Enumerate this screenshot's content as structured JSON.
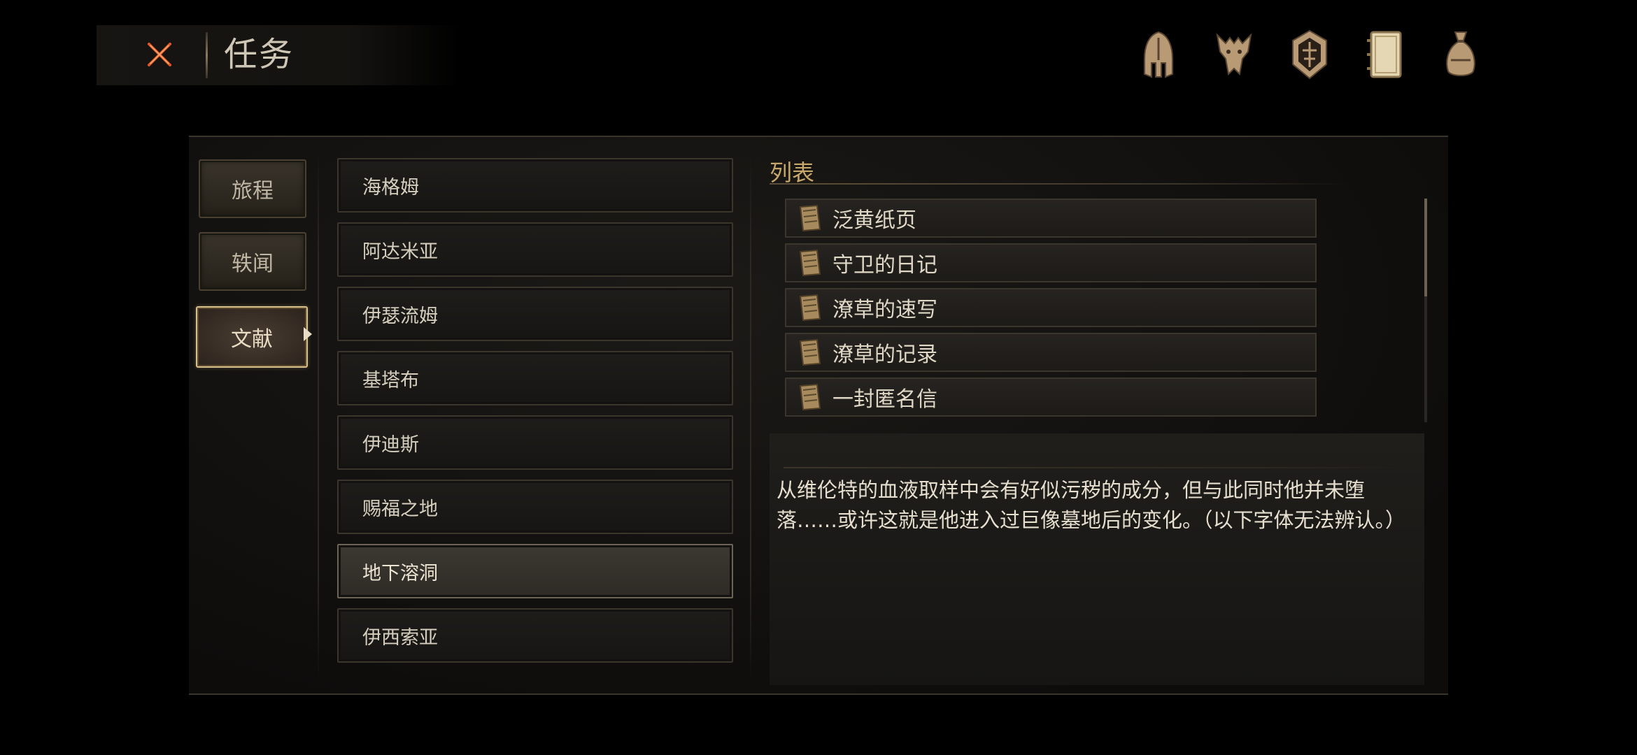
{
  "header": {
    "title": "任务"
  },
  "top_icons": [
    "helmet-icon",
    "beast-mask-icon",
    "emblem-shield-icon",
    "journal-icon",
    "pouch-icon"
  ],
  "categories": [
    {
      "label": "旅程",
      "active": false
    },
    {
      "label": "轶闻",
      "active": false
    },
    {
      "label": "文献",
      "active": true
    }
  ],
  "locations": [
    {
      "label": "海格姆",
      "active": false
    },
    {
      "label": "阿达米亚",
      "active": false
    },
    {
      "label": "伊瑟流姆",
      "active": false
    },
    {
      "label": "基塔布",
      "active": false
    },
    {
      "label": "伊迪斯",
      "active": false
    },
    {
      "label": "赐福之地",
      "active": false
    },
    {
      "label": "地下溶洞",
      "active": true
    },
    {
      "label": "伊西索亚",
      "active": false
    }
  ],
  "list": {
    "title": "列表",
    "items": [
      "泛黄纸页",
      "守卫的日记",
      "潦草的速写",
      "潦草的记录",
      "一封匿名信"
    ]
  },
  "description": {
    "text": "从维伦特的血液取样中会有好似污秽的成分，但与此同时他并未堕落……或许这就是他进入过巨像墓地后的变化。（以下字体无法辨认。）"
  },
  "colors": {
    "accent": "#d9c08a",
    "title_gold": "#c7a76a",
    "close_red": "#e0572a"
  }
}
